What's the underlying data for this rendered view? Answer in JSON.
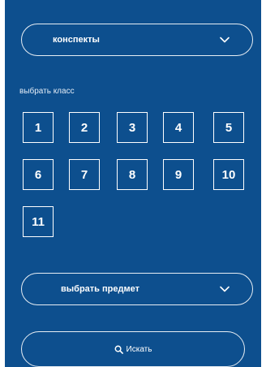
{
  "filter": {
    "type_select": {
      "value": "конспекты"
    },
    "grade_section_label": "выбрать класс",
    "grades": [
      "1",
      "2",
      "3",
      "4",
      "5",
      "6",
      "7",
      "8",
      "9",
      "10",
      "11"
    ],
    "subject_select": {
      "placeholder": "выбрать предмет"
    },
    "search_button": {
      "label": "Искать",
      "icon": "search-icon"
    }
  },
  "colors": {
    "panel_background": "#0d4f8e",
    "border": "#ffffff",
    "text": "#ffffff"
  }
}
